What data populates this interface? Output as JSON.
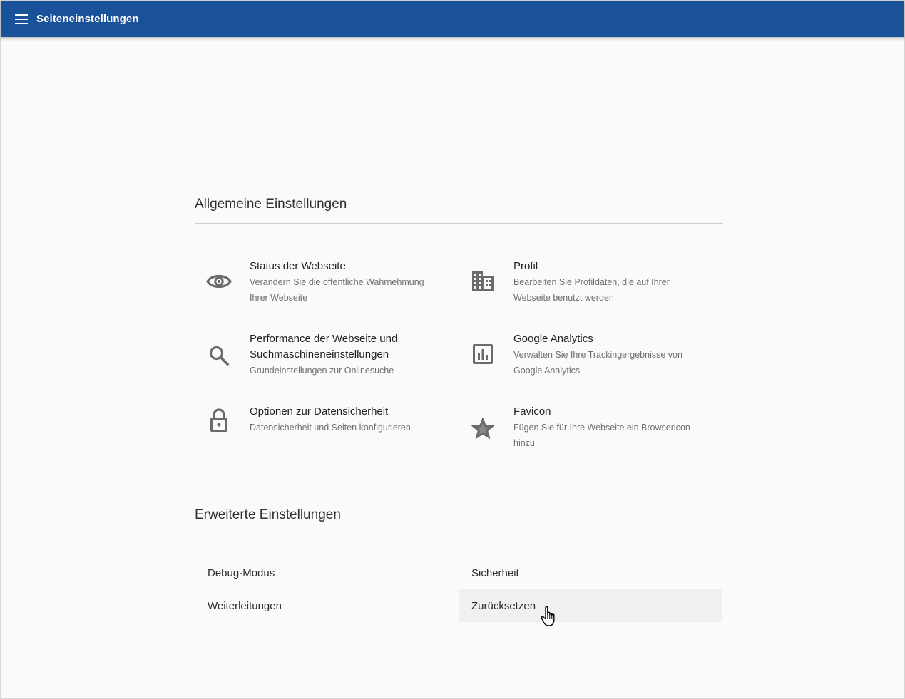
{
  "appbar": {
    "title": "Seiteneinstellungen",
    "menu_icon": "hamburger-menu-icon",
    "color": "#1a529a"
  },
  "general": {
    "title": "Allgemeine Einstellungen",
    "items": [
      {
        "icon": "eye-icon",
        "label": "Status der Webseite",
        "desc": "Verändern Sie die öffentliche Wahrnehmung Ihrer Webseite"
      },
      {
        "icon": "building-icon",
        "label": "Profil",
        "desc": "Bearbeiten Sie Profildaten, die auf Ihrer Webseite benutzt werden"
      },
      {
        "icon": "search-icon",
        "label": "Performance der Webseite und Suchmaschineneinstellungen",
        "desc": "Grundeinstellungen zur Onlinesuche"
      },
      {
        "icon": "bar-chart-icon",
        "label": "Google Analytics",
        "desc": "Verwalten Sie Ihre Trackingergebnisse von Google Analytics"
      },
      {
        "icon": "lock-icon",
        "label": "Optionen zur Datensicherheit",
        "desc": "Datensicherheit und Seiten konfigurieren"
      },
      {
        "icon": "star-icon",
        "label": "Favicon",
        "desc": "Fügen Sie für Ihre Webseite ein Browsericon hinzu"
      }
    ]
  },
  "advanced": {
    "title": "Erweiterte Einstellungen",
    "items": [
      {
        "label": "Debug-Modus"
      },
      {
        "label": "Sicherheit"
      },
      {
        "label": "Weiterleitungen"
      },
      {
        "label": "Zurücksetzen"
      }
    ]
  },
  "colors": {
    "icon": "#6b6b6b",
    "hover_bg": "#f0f0f0"
  }
}
